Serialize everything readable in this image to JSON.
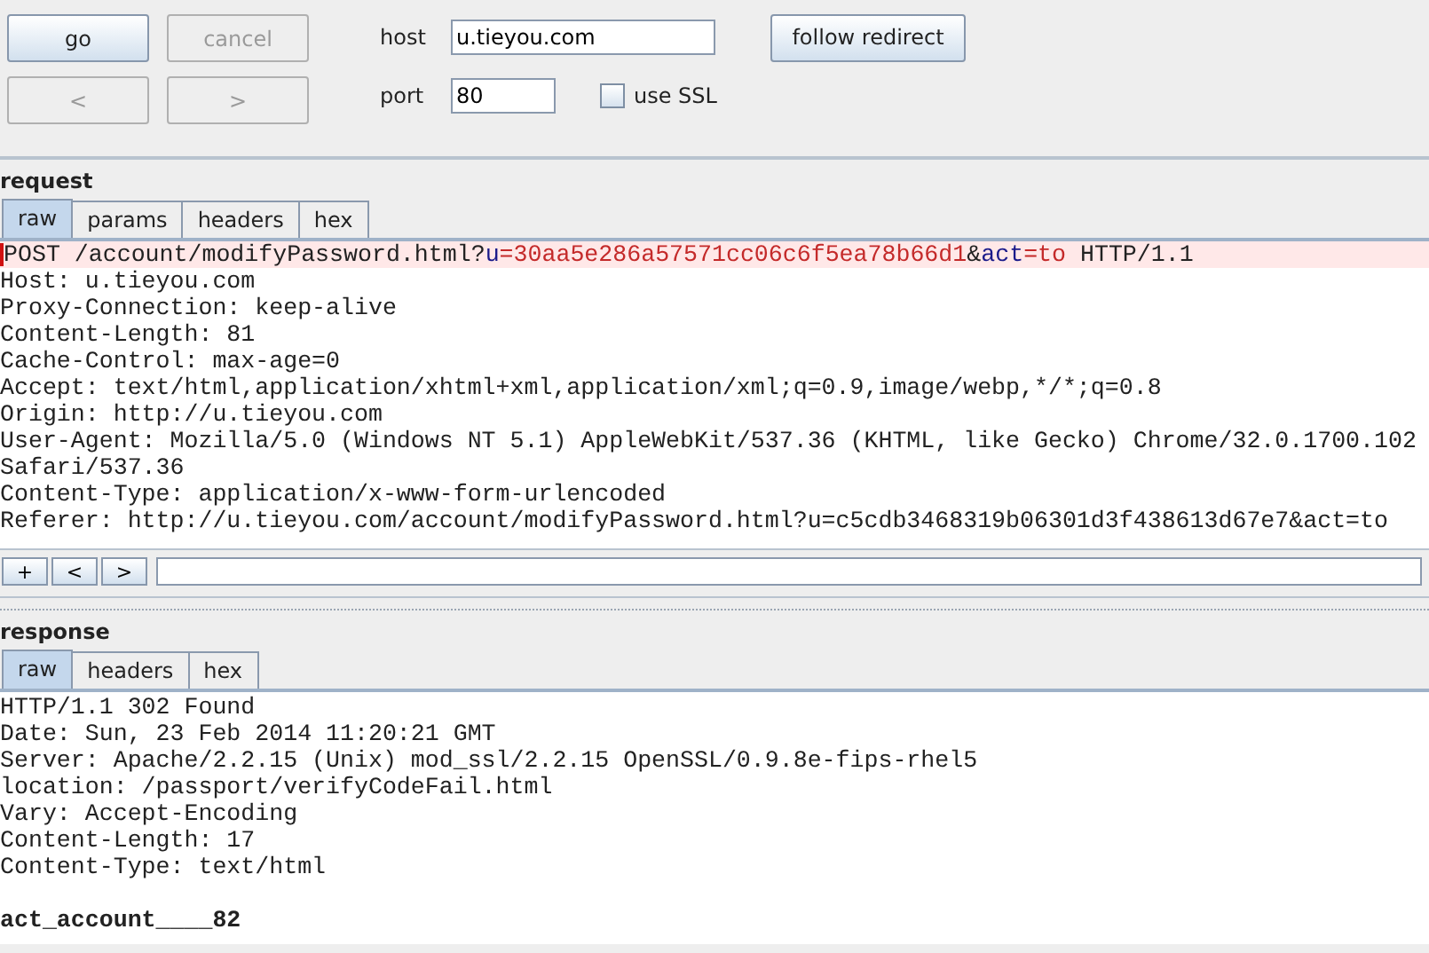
{
  "toolbar": {
    "buttons": [
      {
        "label": "go",
        "disabled": false
      },
      {
        "label": "cancel",
        "disabled": true
      },
      {
        "label": "<",
        "disabled": true
      },
      {
        "label": ">",
        "disabled": true
      }
    ],
    "host": {
      "label": "host",
      "value": "u.tieyou.com"
    },
    "port": {
      "label": "port",
      "value": "80"
    },
    "use_ssl": {
      "label": "use SSL",
      "checked": false
    },
    "follow_redirect": {
      "label": "follow redirect",
      "disabled": false
    }
  },
  "request": {
    "title": "request",
    "tabs": [
      {
        "label": "raw",
        "selected": true
      },
      {
        "label": "params",
        "selected": false
      },
      {
        "label": "headers",
        "selected": false
      },
      {
        "label": "hex",
        "selected": false
      }
    ],
    "lines": [
      {
        "highlighted": true,
        "segments": [
          {
            "kind": "text",
            "text": "POST /account/modifyPassword.html?"
          },
          {
            "kind": "param_name",
            "text": "u"
          },
          {
            "kind": "param_value",
            "text": "=30aa5e286a57571cc06c6f5ea78b66d1"
          },
          {
            "kind": "text",
            "text": "&"
          },
          {
            "kind": "param_name",
            "text": "act"
          },
          {
            "kind": "param_value",
            "text": "=to"
          },
          {
            "kind": "text",
            "text": " HTTP/1.1"
          }
        ]
      },
      {
        "highlighted": false,
        "segments": [
          {
            "kind": "text",
            "text": "Host: u.tieyou.com"
          }
        ]
      },
      {
        "highlighted": false,
        "segments": [
          {
            "kind": "text",
            "text": "Proxy-Connection: keep-alive"
          }
        ]
      },
      {
        "highlighted": false,
        "segments": [
          {
            "kind": "text",
            "text": "Content-Length: 81"
          }
        ]
      },
      {
        "highlighted": false,
        "segments": [
          {
            "kind": "text",
            "text": "Cache-Control: max-age=0"
          }
        ]
      },
      {
        "highlighted": false,
        "segments": [
          {
            "kind": "text",
            "text": "Accept: text/html,application/xhtml+xml,application/xml;q=0.9,image/webp,*/*;q=0.8"
          }
        ]
      },
      {
        "highlighted": false,
        "segments": [
          {
            "kind": "text",
            "text": "Origin: http://u.tieyou.com"
          }
        ]
      },
      {
        "highlighted": false,
        "segments": [
          {
            "kind": "text",
            "text": "User-Agent: Mozilla/5.0 (Windows NT 5.1) AppleWebKit/537.36 (KHTML, like Gecko) Chrome/32.0.1700.102"
          }
        ]
      },
      {
        "highlighted": false,
        "segments": [
          {
            "kind": "text",
            "text": "Safari/537.36"
          }
        ]
      },
      {
        "highlighted": false,
        "segments": [
          {
            "kind": "text",
            "text": "Content-Type: application/x-www-form-urlencoded"
          }
        ]
      },
      {
        "highlighted": false,
        "segments": [
          {
            "kind": "text",
            "text": "Referer: http://u.tieyou.com/account/modifyPassword.html?u=c5cdb3468319b06301d3f438613d67e7&act=to"
          }
        ]
      }
    ],
    "nav_buttons": [
      "+",
      "<",
      ">"
    ]
  },
  "response": {
    "title": "response",
    "tabs": [
      {
        "label": "raw",
        "selected": true
      },
      {
        "label": "headers",
        "selected": false
      },
      {
        "label": "hex",
        "selected": false
      }
    ],
    "lines": [
      {
        "kind": "header",
        "text": "HTTP/1.1 302 Found"
      },
      {
        "kind": "header",
        "text": "Date: Sun, 23 Feb 2014 11:20:21 GMT"
      },
      {
        "kind": "header",
        "text": "Server: Apache/2.2.15 (Unix) mod_ssl/2.2.15 OpenSSL/0.9.8e-fips-rhel5"
      },
      {
        "kind": "header",
        "text": "location: /passport/verifyCodeFail.html"
      },
      {
        "kind": "header",
        "text": "Vary: Accept-Encoding"
      },
      {
        "kind": "header",
        "text": "Content-Length: 17"
      },
      {
        "kind": "header",
        "text": "Content-Type: text/html"
      },
      {
        "kind": "blank"
      },
      {
        "kind": "body",
        "text": "act_account____82"
      }
    ]
  }
}
